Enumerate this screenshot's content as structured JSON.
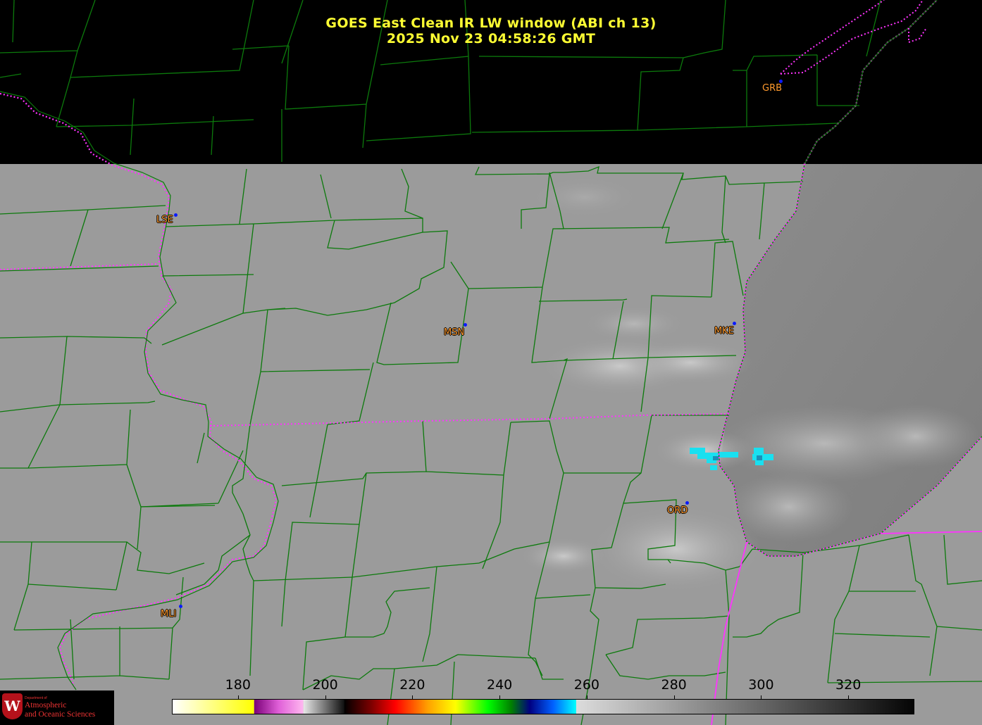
{
  "title": {
    "line1": "GOES East Clean IR LW window (ABI ch 13)",
    "line2": "2025 Nov 23  04:58:26 GMT"
  },
  "stations": [
    {
      "code": "GRB",
      "style": "plain"
    },
    {
      "code": "LSE",
      "style": "halo"
    },
    {
      "code": "MSN",
      "style": "halo"
    },
    {
      "code": "MKE",
      "style": "halo"
    },
    {
      "code": "ORD",
      "style": "halo"
    },
    {
      "code": "MLI",
      "style": "halo"
    }
  ],
  "colorbar": {
    "unit_range": [
      165,
      335
    ],
    "ticks": [
      "180",
      "200",
      "220",
      "240",
      "260",
      "280",
      "300",
      "320"
    ],
    "tick_values": [
      180,
      200,
      220,
      240,
      260,
      280,
      300,
      320
    ]
  },
  "logo": {
    "department": "Department of",
    "line1": "Atmospheric",
    "line2": "and Oceanic Sciences",
    "seal_letter": "W"
  },
  "colors": {
    "county_lines": "#0c7a0c",
    "state_borders": "#ff33ff",
    "title": "#ffff33",
    "station_label": "#ff9a2e",
    "station_dot": "#0a1aff",
    "cold_cloud": "#19e0f0"
  }
}
